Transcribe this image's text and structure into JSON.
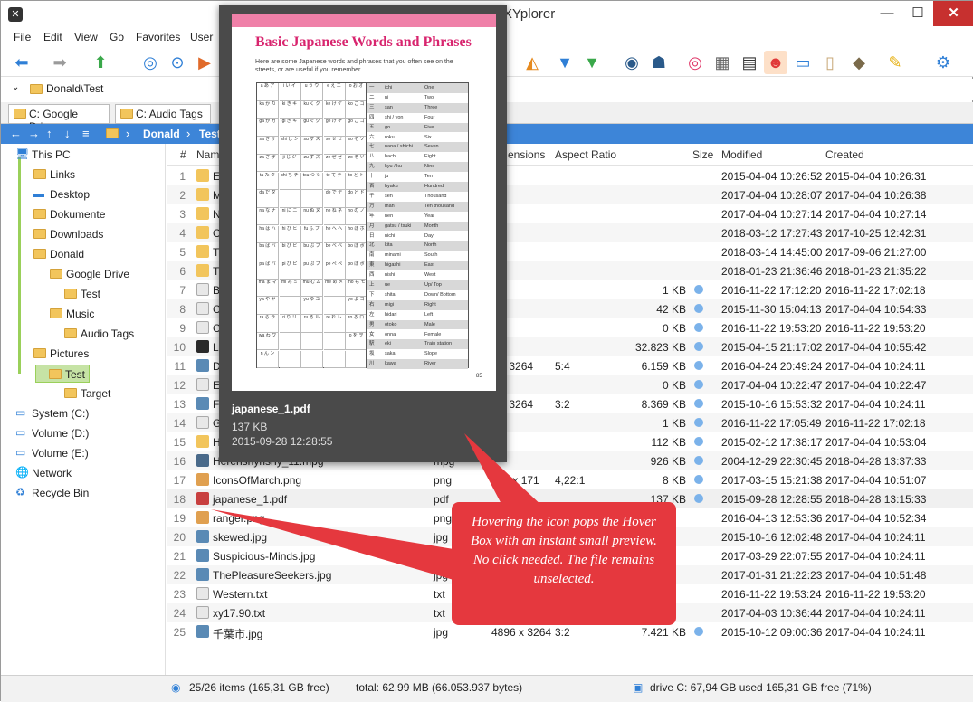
{
  "window": {
    "title": "XYplorer"
  },
  "menu": [
    "File",
    "Edit",
    "View",
    "Go",
    "Favorites",
    "User"
  ],
  "address": "Donald\\Test",
  "tabs": [
    "C: Google Drive",
    "C: Audio Tags"
  ],
  "breadcrumb": [
    "Donald",
    "Test"
  ],
  "tree": [
    {
      "label": "This PC",
      "icon": "monitor-icon"
    },
    {
      "label": "Links",
      "icon": "folder-icon"
    },
    {
      "label": "Desktop",
      "icon": "desktop-icon"
    },
    {
      "label": "Dokumente",
      "icon": "folder-icon"
    },
    {
      "label": "Downloads",
      "icon": "folder-icon"
    },
    {
      "label": "Donald",
      "icon": "folder-icon"
    },
    {
      "label": "Google Drive",
      "icon": "folder-icon"
    },
    {
      "label": "Test",
      "icon": "folder-icon"
    },
    {
      "label": "Music",
      "icon": "folder-icon"
    },
    {
      "label": "Audio Tags",
      "icon": "folder-icon"
    },
    {
      "label": "Pictures",
      "icon": "folder-icon"
    },
    {
      "label": "Test",
      "icon": "folder-icon"
    },
    {
      "label": "Target",
      "icon": "folder-icon"
    },
    {
      "label": "System (C:)",
      "icon": "drive-icon"
    },
    {
      "label": "Volume (D:)",
      "icon": "drive-icon"
    },
    {
      "label": "Volume (E:)",
      "icon": "drive-icon"
    },
    {
      "label": "Network",
      "icon": "network-icon"
    },
    {
      "label": "Recycle Bin",
      "icon": "recycle-bin-icon"
    }
  ],
  "columns": {
    "num": "#",
    "name": "Name",
    "dimensions": "ensions",
    "aspect": "Aspect Ratio",
    "size": "Size",
    "modified": "Modified",
    "created": "Created"
  },
  "rows": [
    {
      "n": "1",
      "name": "Er",
      "type": "",
      "dim": "",
      "aspect": "",
      "size": "",
      "mod": "2015-04-04 10:26:52",
      "cre": "2015-04-04 10:26:31",
      "kind": "folder"
    },
    {
      "n": "2",
      "name": "M",
      "type": "",
      "dim": "",
      "aspect": "",
      "size": "",
      "mod": "2017-04-04 10:28:07",
      "cre": "2017-04-04 10:26:38",
      "kind": "folder"
    },
    {
      "n": "3",
      "name": "N",
      "type": "",
      "dim": "",
      "aspect": "",
      "size": "",
      "mod": "2017-04-04 10:27:14",
      "cre": "2017-04-04 10:27:14",
      "kind": "folder"
    },
    {
      "n": "4",
      "name": "O",
      "type": "",
      "dim": "",
      "aspect": "",
      "size": "",
      "mod": "2018-03-12 17:27:43",
      "cre": "2017-10-25 12:42:31",
      "kind": "folder"
    },
    {
      "n": "5",
      "name": "T",
      "type": "",
      "dim": "",
      "aspect": "",
      "size": "",
      "mod": "2018-03-14 14:45:00",
      "cre": "2017-09-06 21:27:00",
      "kind": "folder"
    },
    {
      "n": "6",
      "name": "T",
      "type": "",
      "dim": "",
      "aspect": "",
      "size": "",
      "mod": "2018-01-23 21:36:46",
      "cre": "2018-01-23 21:35:22",
      "kind": "folder"
    },
    {
      "n": "7",
      "name": "B",
      "type": "",
      "dim": "",
      "aspect": "",
      "size": "1 KB",
      "mod": "2016-11-22 17:12:20",
      "cre": "2016-11-22 17:02:18",
      "kind": "file"
    },
    {
      "n": "8",
      "name": "C",
      "type": "",
      "dim": "",
      "aspect": "",
      "size": "42 KB",
      "mod": "2015-11-30 15:04:13",
      "cre": "2017-04-04 10:54:33",
      "kind": "file"
    },
    {
      "n": "9",
      "name": "C",
      "type": "",
      "dim": "",
      "aspect": "",
      "size": "0 KB",
      "mod": "2016-11-22 19:53:20",
      "cre": "2016-11-22 19:53:20",
      "kind": "file"
    },
    {
      "n": "10",
      "name": "Lr",
      "type": "",
      "dim": "",
      "aspect": "",
      "size": "32.823 KB",
      "mod": "2015-04-15 21:17:02",
      "cre": "2017-04-04 10:55:42",
      "kind": "lr"
    },
    {
      "n": "11",
      "name": "D",
      "type": "",
      "dim": "0 x 3264",
      "aspect": "5:4",
      "size": "6.159 KB",
      "mod": "2016-04-24 20:49:24",
      "cre": "2017-04-04 10:24:11",
      "kind": "img"
    },
    {
      "n": "12",
      "name": "E",
      "type": "",
      "dim": "",
      "aspect": "",
      "size": "0 KB",
      "mod": "2017-04-04 10:22:47",
      "cre": "2017-04-04 10:22:47",
      "kind": "file"
    },
    {
      "n": "13",
      "name": "F",
      "type": "",
      "dim": "6 x 3264",
      "aspect": "3:2",
      "size": "8.369 KB",
      "mod": "2015-10-16 15:53:32",
      "cre": "2017-04-04 10:24:11",
      "kind": "img"
    },
    {
      "n": "14",
      "name": "G",
      "type": "",
      "dim": "",
      "aspect": "",
      "size": "1 KB",
      "mod": "2016-11-22 17:05:49",
      "cre": "2016-11-22 17:02:18",
      "kind": "file"
    },
    {
      "n": "15",
      "name": "H",
      "type": "",
      "dim": "",
      "aspect": "",
      "size": "112 KB",
      "mod": "2015-02-12 17:38:17",
      "cre": "2017-04-04 10:53:04",
      "kind": "folder"
    },
    {
      "n": "16",
      "name": "Herenshyrishy_11.mpg",
      "type": "mpg",
      "dim": "",
      "aspect": "",
      "size": "926 KB",
      "mod": "2004-12-29 22:30:45",
      "cre": "2018-04-28 13:37:33",
      "kind": "video"
    },
    {
      "n": "17",
      "name": "IconsOfMarch.png",
      "type": "png",
      "dim": "721 x 171",
      "aspect": "4,22:1",
      "size": "8 KB",
      "mod": "2017-03-15 15:21:38",
      "cre": "2017-04-04 10:51:07",
      "kind": "png"
    },
    {
      "n": "18",
      "name": "japanese_1.pdf",
      "type": "pdf",
      "dim": "",
      "aspect": "",
      "size": "137 KB",
      "mod": "2015-09-28 12:28:55",
      "cre": "2018-04-28 13:15:33",
      "kind": "pdf"
    },
    {
      "n": "19",
      "name": "ranger.png",
      "type": "png",
      "dim": "",
      "aspect": "",
      "size": "",
      "mod": "2016-04-13 12:53:36",
      "cre": "2017-04-04 10:52:34",
      "kind": "png"
    },
    {
      "n": "20",
      "name": "skewed.jpg",
      "type": "jpg",
      "dim": "",
      "aspect": "",
      "size": "",
      "mod": "2015-10-16 12:02:48",
      "cre": "2017-04-04 10:24:11",
      "kind": "img"
    },
    {
      "n": "21",
      "name": "Suspicious-Minds.jpg",
      "type": "jpg",
      "dim": "",
      "aspect": "",
      "size": "",
      "mod": "2017-03-29 22:07:55",
      "cre": "2017-04-04 10:24:11",
      "kind": "img"
    },
    {
      "n": "22",
      "name": "ThePleasureSeekers.jpg",
      "type": "jpg",
      "dim": "",
      "aspect": "",
      "size": "",
      "mod": "2017-01-31 21:22:23",
      "cre": "2017-04-04 10:51:48",
      "kind": "img"
    },
    {
      "n": "23",
      "name": "Western.txt",
      "type": "txt",
      "dim": "",
      "aspect": "",
      "size": "",
      "mod": "2016-11-22 19:53:24",
      "cre": "2016-11-22 19:53:20",
      "kind": "file"
    },
    {
      "n": "24",
      "name": "xy17.90.txt",
      "type": "txt",
      "dim": "",
      "aspect": "",
      "size": "",
      "mod": "2017-04-03 10:36:44",
      "cre": "2017-04-04 10:24:11",
      "kind": "file"
    },
    {
      "n": "25",
      "name": "千葉市.jpg",
      "type": "jpg",
      "dim": "4896 x 3264",
      "aspect": "3:2",
      "size": "7.421 KB",
      "mod": "2015-10-12 09:00:36",
      "cre": "2017-04-04 10:24:11",
      "kind": "img"
    }
  ],
  "preview": {
    "name": "japanese_1.pdf",
    "size": "137 KB",
    "date": "2015-09-28 12:28:55",
    "doc_title": "Basic Japanese Words and Phrases",
    "doc_intro": "Here are some Japanese words and phrases that you often see on the streets, or are useful if you remember.",
    "page_num": "85",
    "kana": [
      [
        "a あ ア",
        "i い イ",
        "u う ウ",
        "e え エ",
        "o お オ"
      ],
      [
        "ka か カ",
        "ki き キ",
        "ku く ク",
        "ke け ケ",
        "ko こ コ"
      ],
      [
        "ga が ガ",
        "gi ぎ ギ",
        "gu ぐ グ",
        "ge げ ゲ",
        "go ご ゴ"
      ],
      [
        "sa さ サ",
        "shi し シ",
        "su す ス",
        "se せ セ",
        "so そ ソ"
      ],
      [
        "za ざ ザ",
        "ji じ ジ",
        "zu ず ズ",
        "ze ぜ ゼ",
        "zo ぞ ゾ"
      ],
      [
        "ta た タ",
        "chi ち チ",
        "tsu つ ツ",
        "te て テ",
        "to と ト"
      ],
      [
        "da だ ダ",
        "",
        "",
        "de で デ",
        "do ど ド"
      ],
      [
        "na な ナ",
        "ni に ニ",
        "nu ぬ ヌ",
        "ne ね ネ",
        "no の ノ"
      ],
      [
        "ha は ハ",
        "hi ひ ヒ",
        "fu ふ フ",
        "he へ ヘ",
        "ho ほ ホ"
      ],
      [
        "ba ば バ",
        "bi び ビ",
        "bu ぶ ブ",
        "be べ ベ",
        "bo ぼ ボ"
      ],
      [
        "pa ぱ パ",
        "pi ぴ ピ",
        "pu ぷ プ",
        "pe ぺ ペ",
        "po ぽ ポ"
      ],
      [
        "ma ま マ",
        "mi み ミ",
        "mu む ム",
        "me め メ",
        "mo も モ"
      ],
      [
        "ya や ヤ",
        "",
        "yu ゆ ユ",
        "",
        "yo よ ヨ"
      ],
      [
        "ra ら ラ",
        "ri り リ",
        "ru る ル",
        "re れ レ",
        "ro ろ ロ"
      ],
      [
        "wa わ ワ",
        "",
        "",
        "",
        "o を ヲ"
      ],
      [
        "n ん ン",
        "",
        "",
        "",
        ""
      ]
    ],
    "words": [
      [
        "一",
        "ichi",
        "One"
      ],
      [
        "二",
        "ni",
        "Two"
      ],
      [
        "三",
        "san",
        "Three"
      ],
      [
        "四",
        "shi / yon",
        "Four"
      ],
      [
        "五",
        "go",
        "Five"
      ],
      [
        "六",
        "roku",
        "Six"
      ],
      [
        "七",
        "nana / shichi",
        "Seven"
      ],
      [
        "八",
        "hachi",
        "Eight"
      ],
      [
        "九",
        "kyu / ku",
        "Nine"
      ],
      [
        "十",
        "ju",
        "Ten"
      ],
      [
        "百",
        "hyaku",
        "Hundred"
      ],
      [
        "千",
        "sen",
        "Thousand"
      ],
      [
        "万",
        "man",
        "Ten thousand"
      ],
      [
        "年",
        "nen",
        "Year"
      ],
      [
        "月",
        "gatsu / tsuki",
        "Month"
      ],
      [
        "日",
        "nichi",
        "Day"
      ],
      [
        "北",
        "kita",
        "North"
      ],
      [
        "南",
        "minami",
        "South"
      ],
      [
        "東",
        "higashi",
        "East"
      ],
      [
        "西",
        "nishi",
        "West"
      ],
      [
        "上",
        "ue",
        "Up/ Top"
      ],
      [
        "下",
        "shita",
        "Down/ Bottom"
      ],
      [
        "右",
        "migi",
        "Right"
      ],
      [
        "左",
        "hidari",
        "Left"
      ],
      [
        "男",
        "otoko",
        "Male"
      ],
      [
        "女",
        "onna",
        "Female"
      ],
      [
        "駅",
        "eki",
        "Train station"
      ],
      [
        "坂",
        "saka",
        "Slope"
      ],
      [
        "川",
        "kawa",
        "River"
      ]
    ]
  },
  "callout": "Hovering the icon pops the Hover Box with an instant small preview.\nNo click needed. The file remains unselected.",
  "status": {
    "items": "25/26 items (165,31 GB free)",
    "total": "total: 62,99 MB (66.053.937 bytes)",
    "drive": "drive C:  67,94 GB used   165,31 GB free (71%)"
  },
  "colors": {
    "accent": "#3d85d8",
    "callout": "#e5383e",
    "preview_bg": "#4a4a4a"
  }
}
